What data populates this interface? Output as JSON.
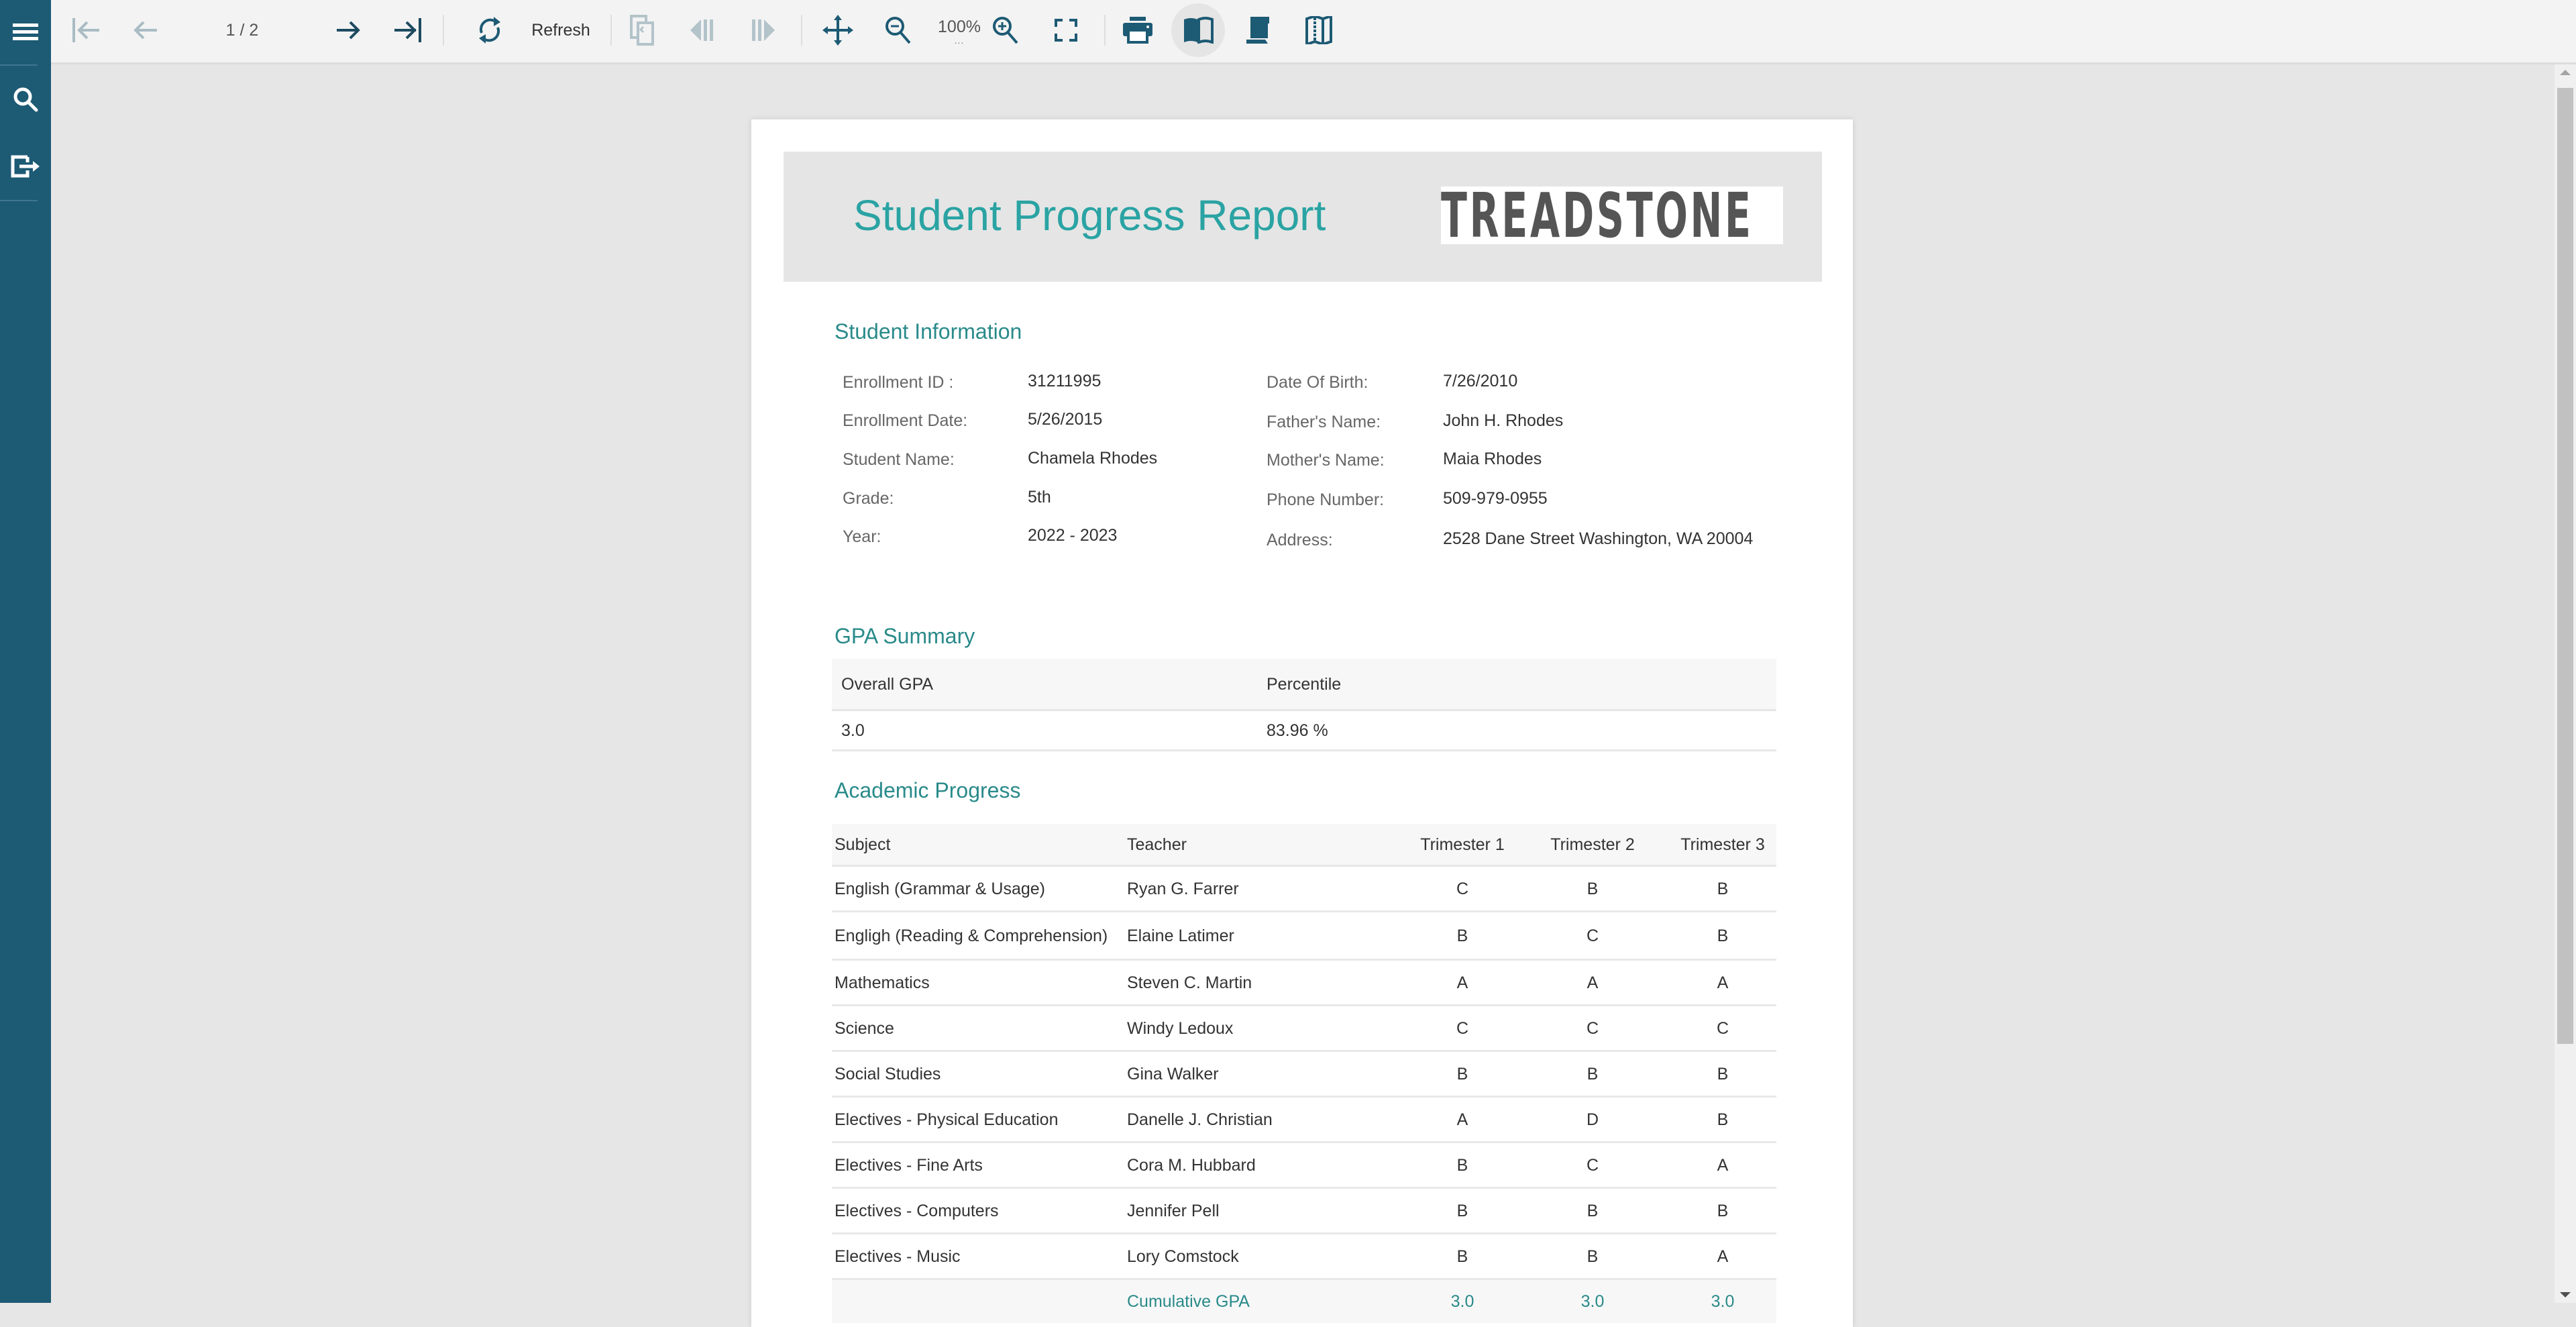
{
  "sidebar": {
    "items": [
      {
        "name": "menu",
        "icon": "hamburger-menu-icon"
      },
      {
        "name": "search",
        "icon": "search-icon"
      },
      {
        "name": "export",
        "icon": "export-icon"
      }
    ]
  },
  "toolbar": {
    "first_page": "first-page-icon",
    "prev_page": "previous-page-icon",
    "page_indicator": "1 / 2",
    "next_page": "next-page-icon",
    "last_page": "last-page-icon",
    "refresh_label": "Refresh",
    "zoom_level": "100%",
    "zoom_dots": "...",
    "buttons": [
      "parent-report-icon",
      "previous-section-icon",
      "next-section-icon",
      "pan-icon",
      "zoom-out-icon",
      "zoom-in-icon",
      "fullscreen-icon",
      "print-icon",
      "book-view-icon",
      "continuous-view-icon",
      "galley-view-icon"
    ]
  },
  "report": {
    "title": "Student Progress Report",
    "logo_text": "TREADSTONE",
    "colors": {
      "accent": "#2aa3a3",
      "heading": "#2a8a8a",
      "brand_dark": "#1d5a74",
      "logo_gray": "#555555"
    },
    "student_info": {
      "heading": "Student Information",
      "left": [
        {
          "label": "Enrollment ID :",
          "value": "31211995"
        },
        {
          "label": "Enrollment Date:",
          "value": "5/26/2015"
        },
        {
          "label": "Student Name:",
          "value": "Chamela Rhodes"
        },
        {
          "label": "Grade:",
          "value": "5th"
        },
        {
          "label": "Year:",
          "value": "2022 - 2023"
        }
      ],
      "right": [
        {
          "label": "Date Of Birth:",
          "value": "7/26/2010"
        },
        {
          "label": "Father's Name:",
          "value": "John H. Rhodes"
        },
        {
          "label": "Mother's Name:",
          "value": "Maia Rhodes"
        },
        {
          "label": "Phone Number:",
          "value": "509-979-0955"
        },
        {
          "label": "Address:",
          "value": "2528 Dane Street Washington, WA 20004"
        }
      ]
    },
    "gpa_summary": {
      "heading": "GPA Summary",
      "columns": [
        "Overall GPA",
        "Percentile"
      ],
      "values": [
        "3.0",
        "83.96 %"
      ]
    },
    "academic_progress": {
      "heading": "Academic Progress",
      "columns": [
        "Subject",
        "Teacher",
        "Trimester 1",
        "Trimester 2",
        "Trimester 3"
      ],
      "rows": [
        {
          "subject": "English (Grammar & Usage)",
          "teacher": "Ryan G. Farrer",
          "t1": "C",
          "t2": "B",
          "t3": "B"
        },
        {
          "subject": "Engligh (Reading & Comprehension)",
          "teacher": "Elaine Latimer",
          "t1": "B",
          "t2": "C",
          "t3": "B"
        },
        {
          "subject": "Mathematics",
          "teacher": "Steven C. Martin",
          "t1": "A",
          "t2": "A",
          "t3": "A"
        },
        {
          "subject": "Science",
          "teacher": "Windy Ledoux",
          "t1": "C",
          "t2": "C",
          "t3": "C"
        },
        {
          "subject": "Social Studies",
          "teacher": "Gina Walker",
          "t1": "B",
          "t2": "B",
          "t3": "B"
        },
        {
          "subject": "Electives - Physical Education",
          "teacher": "Danelle J. Christian",
          "t1": "A",
          "t2": "D",
          "t3": "B"
        },
        {
          "subject": "Electives - Fine Arts",
          "teacher": "Cora M. Hubbard",
          "t1": "B",
          "t2": "C",
          "t3": "A"
        },
        {
          "subject": "Electives - Computers",
          "teacher": "Jennifer Pell",
          "t1": "B",
          "t2": "B",
          "t3": "B"
        },
        {
          "subject": "Electives - Music",
          "teacher": "Lory Comstock",
          "t1": "B",
          "t2": "B",
          "t3": "A"
        }
      ],
      "footer": {
        "label": "Cumulative GPA",
        "t1": "3.0",
        "t2": "3.0",
        "t3": "3.0"
      }
    }
  }
}
